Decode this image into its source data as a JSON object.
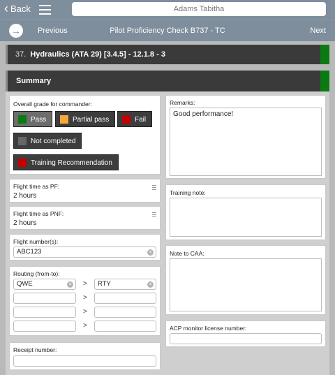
{
  "topbar": {
    "back_label": "Back",
    "title_value": "Adams Tabitha"
  },
  "navbar": {
    "prev_label": "Previous",
    "title": "Pilot Proficiency Check B737 - TC",
    "next_label": "Next"
  },
  "item_header": {
    "number": "37.",
    "title": "Hydraulics (ATA 29) [3.4.5] - 12.1.8 - 3"
  },
  "summary_header": {
    "title": "Summary"
  },
  "grade": {
    "label": "Overall grade for commander:",
    "options": [
      {
        "label": "Pass",
        "color": "#0b7a0f",
        "selected": true
      },
      {
        "label": "Partial pass",
        "color": "#f5a93b",
        "selected": false
      },
      {
        "label": "Fail",
        "color": "#c40000",
        "selected": false
      },
      {
        "label": "Not completed",
        "color": "#666666",
        "selected": false
      },
      {
        "label": "Training Recommendation",
        "color": "#c40000",
        "selected": false
      }
    ]
  },
  "flight_time_pf": {
    "label": "Flight time as PF:",
    "value": "2 hours"
  },
  "flight_time_pnf": {
    "label": "Flight time as PNF:",
    "value": "2 hours"
  },
  "flight_numbers": {
    "label": "Flight number(s):",
    "value": "ABC123"
  },
  "routing": {
    "label": "Routing (from-to):",
    "separator": ">",
    "rows": [
      {
        "from": "QWE",
        "to": "RTY"
      },
      {
        "from": "",
        "to": ""
      },
      {
        "from": "",
        "to": ""
      },
      {
        "from": "",
        "to": ""
      }
    ]
  },
  "receipt": {
    "label": "Receipt number:",
    "value": ""
  },
  "remarks": {
    "label": "Remarks:",
    "value": "Good performance!"
  },
  "training_note": {
    "label": "Training note:",
    "value": ""
  },
  "note_caa": {
    "label": "Note to CAA:",
    "value": ""
  },
  "acp_license": {
    "label": "ACP monitor license number:",
    "value": ""
  }
}
